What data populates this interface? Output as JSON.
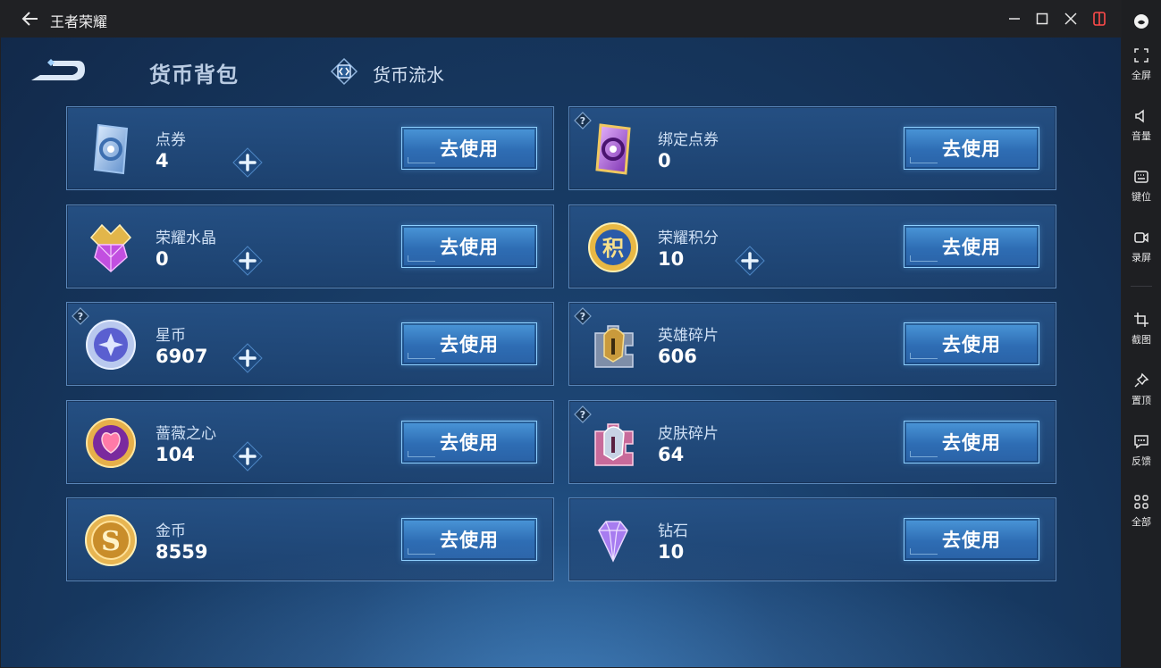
{
  "window": {
    "title": "王者荣耀"
  },
  "sidebar": {
    "items": [
      {
        "label": "全屏",
        "icon": "fullscreen-icon"
      },
      {
        "label": "音量",
        "icon": "volume-icon"
      },
      {
        "label": "键位",
        "icon": "keyboard-icon"
      },
      {
        "label": "录屏",
        "icon": "record-icon"
      },
      {
        "label": "截图",
        "icon": "crop-icon"
      },
      {
        "label": "置顶",
        "icon": "pin-icon"
      },
      {
        "label": "反馈",
        "icon": "feedback-icon"
      },
      {
        "label": "全部",
        "icon": "apps-icon"
      }
    ]
  },
  "header": {
    "active_tab": "货币背包",
    "other_tab": "货币流水"
  },
  "currencies": [
    {
      "name": "点券",
      "value": "4",
      "plus": true,
      "help": false,
      "icon": "voucher-icon",
      "button": "去使用"
    },
    {
      "name": "绑定点券",
      "value": "0",
      "plus": false,
      "help": true,
      "icon": "bound-voucher-icon",
      "button": "去使用"
    },
    {
      "name": "荣耀水晶",
      "value": "0",
      "plus": true,
      "help": false,
      "icon": "glory-crystal-icon",
      "button": "去使用"
    },
    {
      "name": "荣耀积分",
      "value": "10",
      "plus": true,
      "help": false,
      "icon": "glory-points-icon",
      "button": "去使用"
    },
    {
      "name": "星币",
      "value": "6907",
      "plus": true,
      "help": true,
      "icon": "star-coin-icon",
      "button": "去使用"
    },
    {
      "name": "英雄碎片",
      "value": "606",
      "plus": false,
      "help": true,
      "icon": "hero-fragment-icon",
      "button": "去使用"
    },
    {
      "name": "蔷薇之心",
      "value": "104",
      "plus": true,
      "help": false,
      "icon": "rose-heart-icon",
      "button": "去使用"
    },
    {
      "name": "皮肤碎片",
      "value": "64",
      "plus": false,
      "help": true,
      "icon": "skin-fragment-icon",
      "button": "去使用"
    },
    {
      "name": "金币",
      "value": "8559",
      "plus": false,
      "help": false,
      "icon": "gold-coin-icon",
      "button": "去使用"
    },
    {
      "name": "钻石",
      "value": "10",
      "plus": false,
      "help": false,
      "icon": "diamond-icon",
      "button": "去使用"
    }
  ]
}
